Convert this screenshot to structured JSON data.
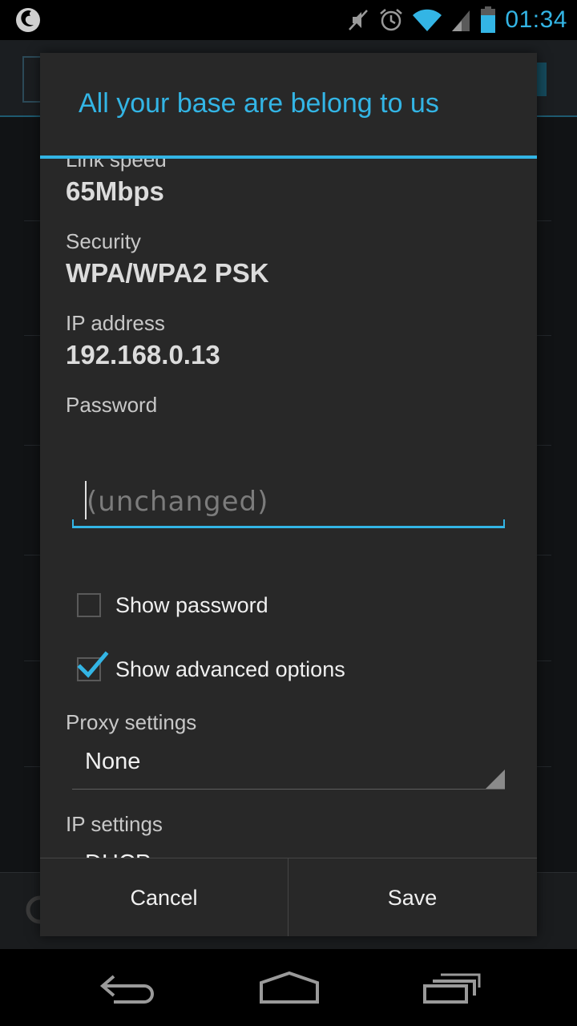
{
  "status_bar": {
    "time": "01:34",
    "icons": [
      "firefox-icon",
      "muted-icon",
      "alarm-icon",
      "wifi-icon",
      "signal-icon",
      "battery-icon"
    ],
    "accent_color": "#33b5e5"
  },
  "dialog": {
    "title": "All your base are belong to us",
    "link_speed_label": "Link speed",
    "link_speed_value": "65Mbps",
    "security_label": "Security",
    "security_value": "WPA/WPA2 PSK",
    "ip_label": "IP address",
    "ip_value": "192.168.0.13",
    "password_label": "Password",
    "password_placeholder": "(unchanged)",
    "password_value": "",
    "show_password": {
      "label": "Show password",
      "checked": false
    },
    "show_advanced": {
      "label": "Show advanced options",
      "checked": true
    },
    "proxy_label": "Proxy settings",
    "proxy_value": "None",
    "ip_settings_label": "IP settings",
    "ip_settings_value": "DHCP",
    "cancel_label": "Cancel",
    "save_label": "Save"
  },
  "nav_bar": {
    "icons": [
      "back-icon",
      "home-icon",
      "recent-apps-icon"
    ]
  }
}
